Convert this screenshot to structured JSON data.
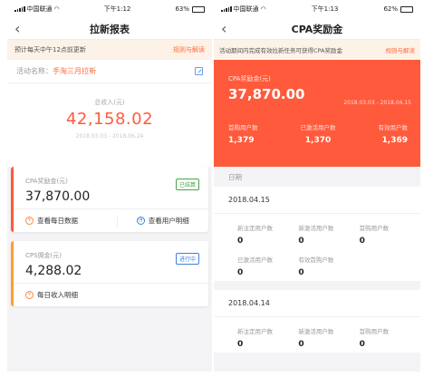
{
  "left": {
    "status": {
      "carrier": "中国联通",
      "time": "下午1:12",
      "battery": "63%",
      "battery_level": 0.63
    },
    "nav": {
      "back": "‹",
      "title": "拉新报表"
    },
    "notice": {
      "text": "预计每天中午12点前更新",
      "link": "规则与解读"
    },
    "activity": {
      "label": "活动名称：",
      "name": "手淘三月拉新",
      "edit_icon": "edit-icon"
    },
    "total": {
      "label": "总收入(元)",
      "amount": "42,158.02",
      "range": "2018.03.03 - 2018.06.24"
    },
    "cpa": {
      "label": "CPA奖励金(元)",
      "amount": "37,870.00",
      "badge": "已结算",
      "actions": [
        "查看每日数据",
        "查看用户明细"
      ]
    },
    "cps": {
      "label": "CPS佣金(元)",
      "amount": "4,288.02",
      "badge": "进行中",
      "actions": [
        "每日收入明细"
      ]
    },
    "colors": {
      "accent": "#ff5a3c",
      "green": "#48a648",
      "blue": "#3f7ee0",
      "orange_bar": "#ff9f2e"
    }
  },
  "right": {
    "status": {
      "carrier": "中国联通",
      "time": "下午1:13",
      "battery": "62%",
      "battery_level": 0.62
    },
    "nav": {
      "back": "‹",
      "title": "CPA奖励金"
    },
    "notice": {
      "text": "活动期间内完成有效拉新任务可获得CPA奖励金",
      "link": "规则与解读"
    },
    "hero": {
      "label": "CPA奖励金(元)",
      "amount": "37,870.00",
      "range": "2018.03.03 - 2018.04.15",
      "stats": [
        {
          "label": "首购用户数",
          "value": "1,379"
        },
        {
          "label": "已激活用户数",
          "value": "1,370"
        },
        {
          "label": "有效用户数",
          "value": "1,369"
        }
      ]
    },
    "date_header": "日期",
    "days": [
      {
        "date": "2018.04.15",
        "cells": [
          {
            "label": "新注定用户数",
            "value": "0"
          },
          {
            "label": "新激活用户数",
            "value": "0"
          },
          {
            "label": "首购用户数",
            "value": "0"
          },
          {
            "label": "已激活用户数",
            "value": "0"
          },
          {
            "label": "有效首购户数",
            "value": "0"
          }
        ]
      },
      {
        "date": "2018.04.14",
        "cells": [
          {
            "label": "新注定用户数",
            "value": "0"
          },
          {
            "label": "新激活用户数",
            "value": "0"
          },
          {
            "label": "首购用户数",
            "value": "0"
          }
        ]
      }
    ]
  }
}
